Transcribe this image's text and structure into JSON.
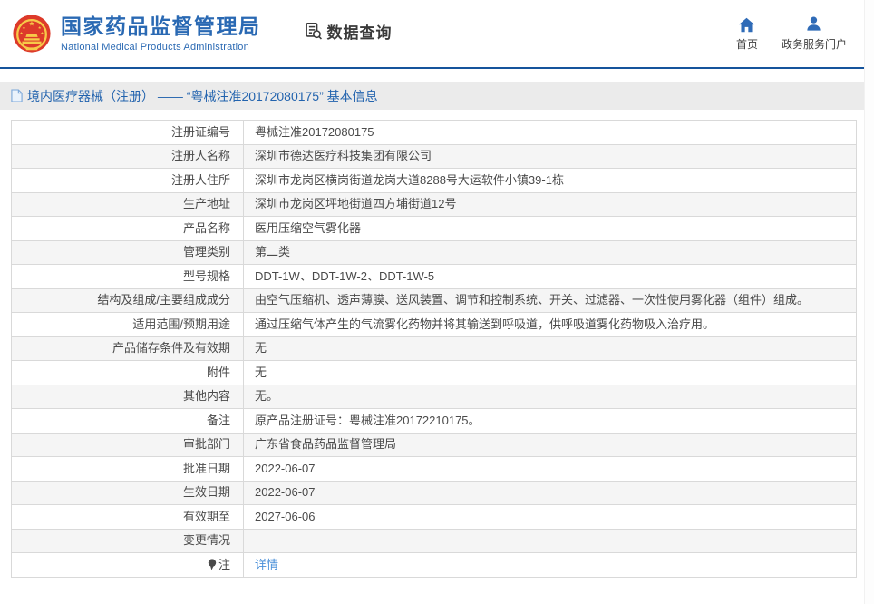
{
  "header": {
    "org_name_zh": "国家药品监督管理局",
    "org_name_en": "National Medical Products Administration",
    "section_label": "数据查询",
    "nav_home": "首页",
    "nav_portal": "政务服务门户"
  },
  "title_bar": {
    "text": "境内医疗器械（注册） —— “粤械注准20172080175” 基本信息"
  },
  "table": {
    "rows": [
      {
        "label": "注册证编号",
        "value": "粤械注准20172080175"
      },
      {
        "label": "注册人名称",
        "value": "深圳市德达医疗科技集团有限公司"
      },
      {
        "label": "注册人住所",
        "value": "深圳市龙岗区横岗街道龙岗大道8288号大运软件小镇39-1栋"
      },
      {
        "label": "生产地址",
        "value": "深圳市龙岗区坪地街道四方埔街道12号"
      },
      {
        "label": "产品名称",
        "value": "医用压缩空气雾化器"
      },
      {
        "label": "管理类别",
        "value": "第二类"
      },
      {
        "label": "型号规格",
        "value": "DDT-1W、DDT-1W-2、DDT-1W-5"
      },
      {
        "label": "结构及组成/主要组成成分",
        "value": "由空气压缩机、透声薄膜、送风装置、调节和控制系统、开关、过滤器、一次性使用雾化器（组件）组成。"
      },
      {
        "label": "适用范围/预期用途",
        "value": "通过压缩气体产生的气流雾化药物并将其输送到呼吸道，供呼吸道雾化药物吸入治疗用。"
      },
      {
        "label": "产品储存条件及有效期",
        "value": "无"
      },
      {
        "label": "附件",
        "value": "无"
      },
      {
        "label": "其他内容",
        "value": "无。"
      },
      {
        "label": "备注",
        "value": "原产品注册证号：粤械注准20172210175。"
      },
      {
        "label": "审批部门",
        "value": "广东省食品药品监督管理局"
      },
      {
        "label": "批准日期",
        "value": "2022-06-07"
      },
      {
        "label": "生效日期",
        "value": "2022-06-07"
      },
      {
        "label": "有效期至",
        "value": "2027-06-06"
      },
      {
        "label": "变更情况",
        "value": ""
      },
      {
        "label": "注",
        "value": "详情",
        "link": true,
        "label_icon": "note-balloon-icon"
      }
    ]
  },
  "colors": {
    "brand_blue": "#2a69b3",
    "line_blue": "#15549c",
    "link_blue": "#4a90d9",
    "title_bar_bg": "#ebebeb",
    "zebra_gray": "#f5f5f5",
    "emblem_red": "#dd3a2a",
    "emblem_gold": "#f7c948"
  }
}
